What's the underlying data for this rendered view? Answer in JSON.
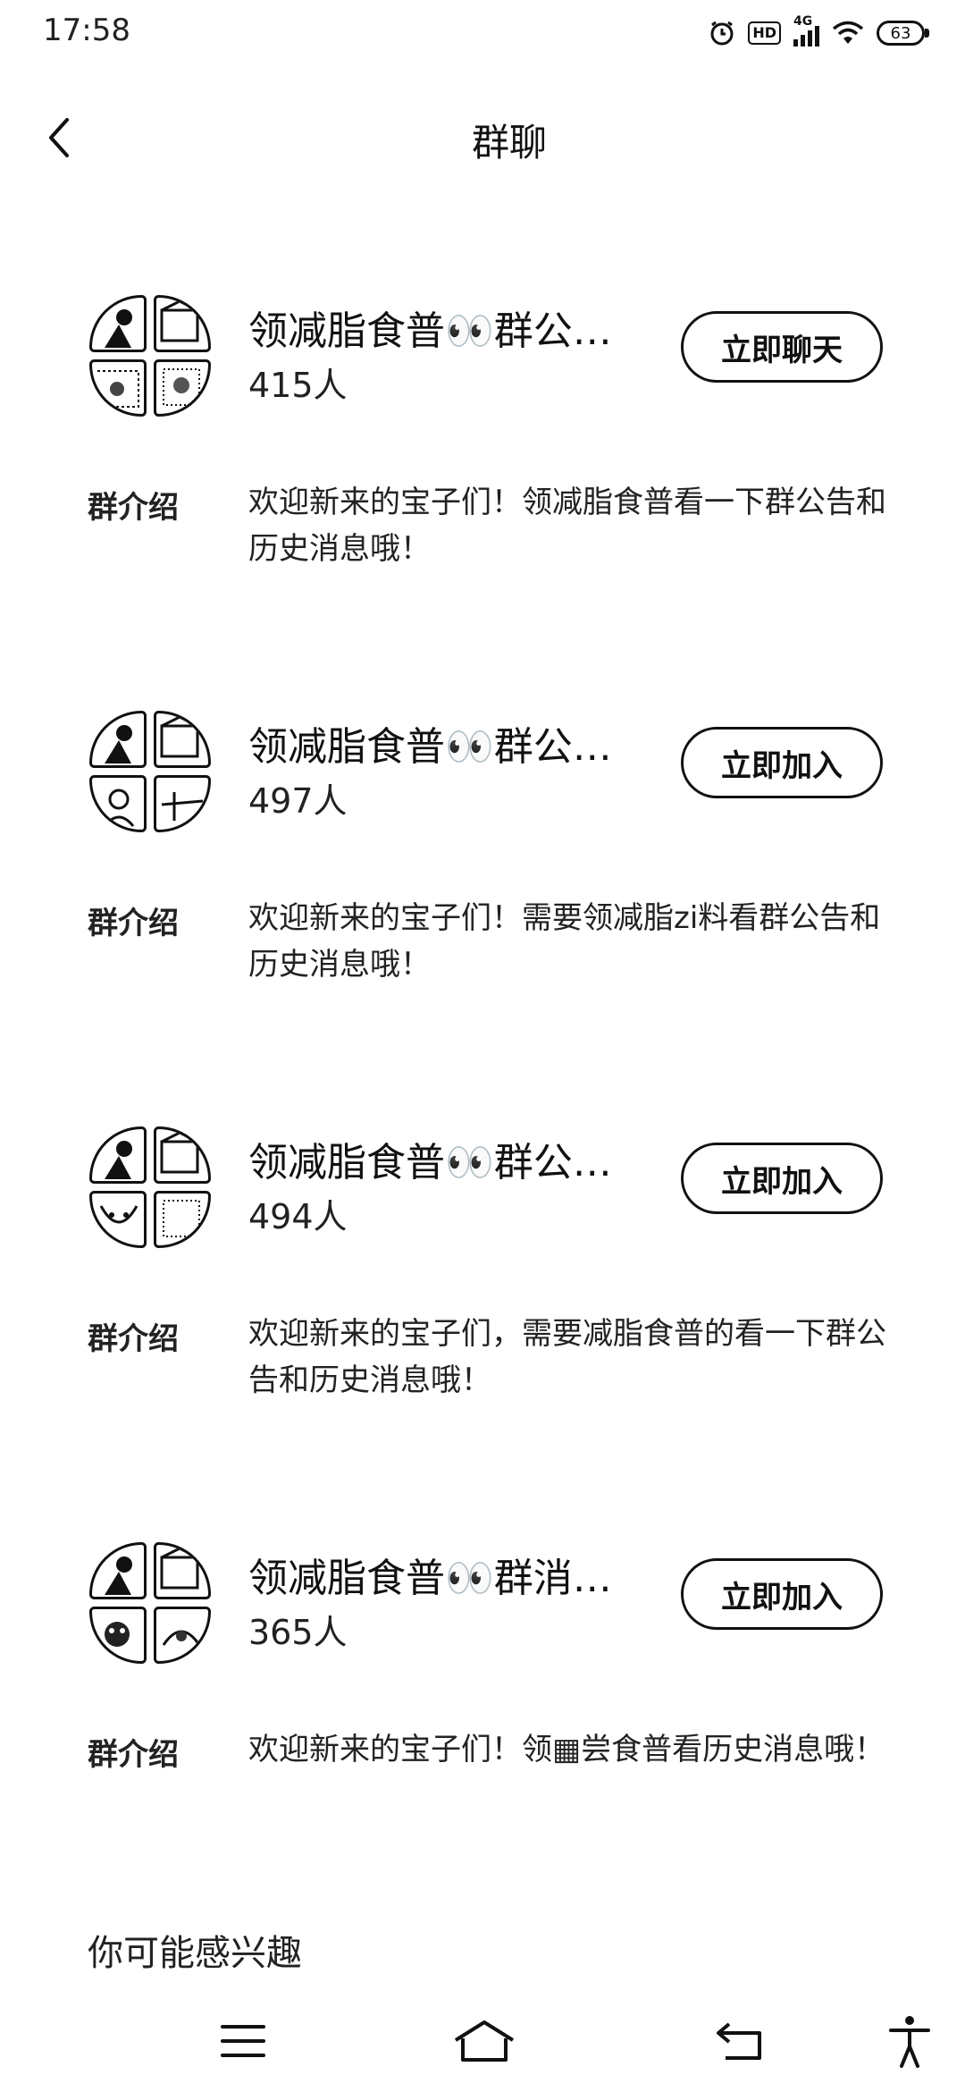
{
  "status_bar": {
    "time": "17:58",
    "network": "4G",
    "hd": "HD",
    "battery": "63"
  },
  "header": {
    "title": "群聊"
  },
  "groups": [
    {
      "name": "领减脂食普👀群公…",
      "members": "415人",
      "button": "立即聊天",
      "intro_label": "群介绍",
      "intro": "欢迎新来的宝子们！领减脂食普看一下群公告和历史消息哦！"
    },
    {
      "name": "领减脂食普👀群公…",
      "members": "497人",
      "button": "立即加入",
      "intro_label": "群介绍",
      "intro": "欢迎新来的宝子们！需要领减脂zi料看群公告和历史消息哦！"
    },
    {
      "name": "领减脂食普👀群公…",
      "members": "494人",
      "button": "立即加入",
      "intro_label": "群介绍",
      "intro": "欢迎新来的宝子们，需要减脂食普的看一下群公告和历史消息哦！"
    },
    {
      "name": "领减脂食普👀群消…",
      "members": "365人",
      "button": "立即加入",
      "intro_label": "群介绍",
      "intro": "欢迎新来的宝子们！领▦尝食普看历史消息哦！"
    }
  ],
  "section": {
    "title": "你可能感兴趣"
  },
  "icons": {
    "back": "chevron-left-icon",
    "menu": "menu-icon",
    "home": "home-icon",
    "return": "return-icon",
    "accessibility": "accessibility-icon"
  }
}
